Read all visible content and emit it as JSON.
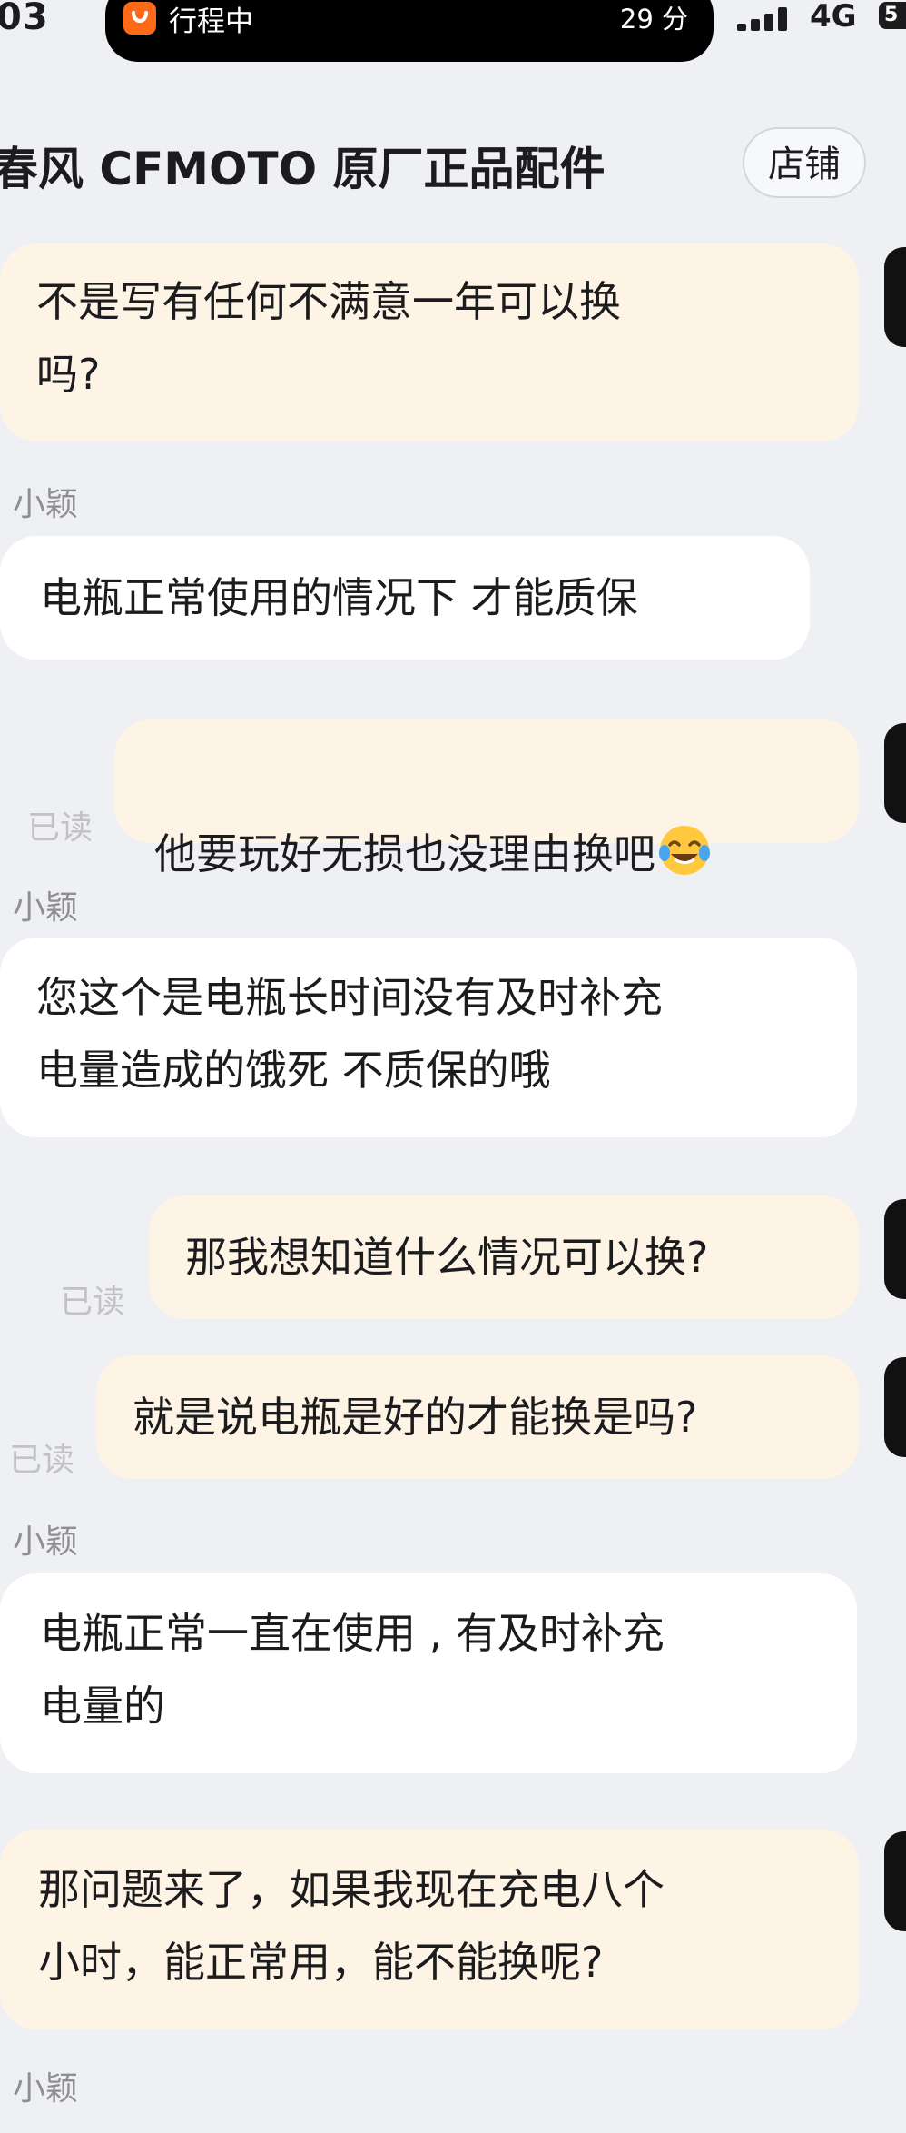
{
  "status_bar": {
    "time": "03",
    "activity_label": "行程中",
    "activity_minutes": "29 分",
    "network": "4G",
    "battery": "5"
  },
  "header": {
    "title": "春风 CFMOTO 原厂正品配件",
    "shop_button": "店铺"
  },
  "messages": [
    {
      "from": "me",
      "text": "不是写有任何不满意一年可以换\n吗?"
    },
    {
      "from": "agent",
      "sender": "小颖",
      "text": "电瓶正常使用的情况下  才能质保"
    },
    {
      "from": "me",
      "read": "已读",
      "text": "他要玩好无损也没理由换吧",
      "emoji": "face-with-tears-of-joy"
    },
    {
      "from": "agent",
      "sender": "小颖",
      "text": "您这个是电瓶长时间没有及时补充\n电量造成的饿死  不质保的哦"
    },
    {
      "from": "me",
      "read": "已读",
      "text": "那我想知道什么情况可以换?"
    },
    {
      "from": "me",
      "read": "已读",
      "text": "就是说电瓶是好的才能换是吗?"
    },
    {
      "from": "agent",
      "sender": "小颖",
      "text": "电瓶正常一直在使用 ,  有及时补充\n电量的"
    },
    {
      "from": "me",
      "text": "那问题来了，如果我现在充电八个\n小时，能正常用，能不能换呢?"
    },
    {
      "from": "agent",
      "sender": "小颖"
    }
  ],
  "colors": {
    "background": "#eef0f4",
    "my_bubble": "#fdf4e6",
    "their_bubble": "#ffffff",
    "meta_text": "#8e8e93"
  },
  "icons": [
    "didi-app-icon",
    "signal-bars-icon",
    "avatar-icon",
    "face-with-tears-of-joy-emoji"
  ]
}
